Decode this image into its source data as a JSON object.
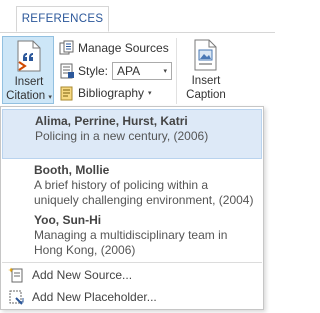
{
  "tabs": {
    "active": "REFERENCES"
  },
  "ribbon": {
    "insert_citation": {
      "label_line1": "Insert",
      "label_line2": "Citation",
      "caret": "▾"
    },
    "manage_sources": {
      "label": "Manage Sources"
    },
    "style": {
      "label": "Style:",
      "value": "APA",
      "caret": "▾"
    },
    "bibliography": {
      "label": "Bibliography",
      "caret": "▾"
    },
    "insert_caption": {
      "label_line1": "Insert",
      "label_line2": "Caption"
    }
  },
  "citation_menu": {
    "items": [
      {
        "author": "Alima, Perrine,  Hurst, Katri",
        "title_lines": [
          "Policing in a new century, (2006)"
        ]
      },
      {
        "author": "Booth, Mollie",
        "title_lines": [
          "A brief history of policing within a",
          "uniquely challenging environment, (2004)"
        ]
      },
      {
        "author": "Yoo, Sun-Hi",
        "title_lines": [
          "Managing a multidisciplinary team in",
          "Hong Kong, (2006)"
        ]
      }
    ],
    "actions": [
      {
        "label": "Add New Source...",
        "icon": "add-source-icon"
      },
      {
        "label": "Add New Placeholder...",
        "icon": "add-placeholder-icon"
      }
    ]
  },
  "colors": {
    "accent": "#2b579a",
    "selected_button_bg": "#cde6f7",
    "highlight_item_bg": "#dde9f7"
  }
}
